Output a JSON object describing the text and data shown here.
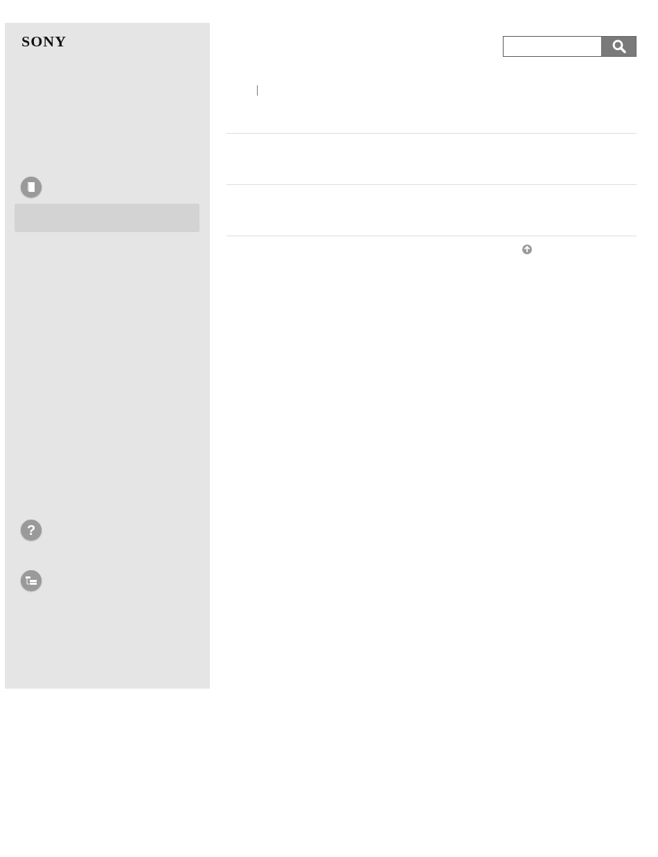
{
  "logo": "SONY",
  "sidebar": {
    "sections": [
      {
        "kind": "book"
      },
      {
        "kind": "help",
        "glyph": "?"
      },
      {
        "kind": "tree"
      }
    ],
    "nav_items": [
      {
        "selected": true
      }
    ]
  }
}
